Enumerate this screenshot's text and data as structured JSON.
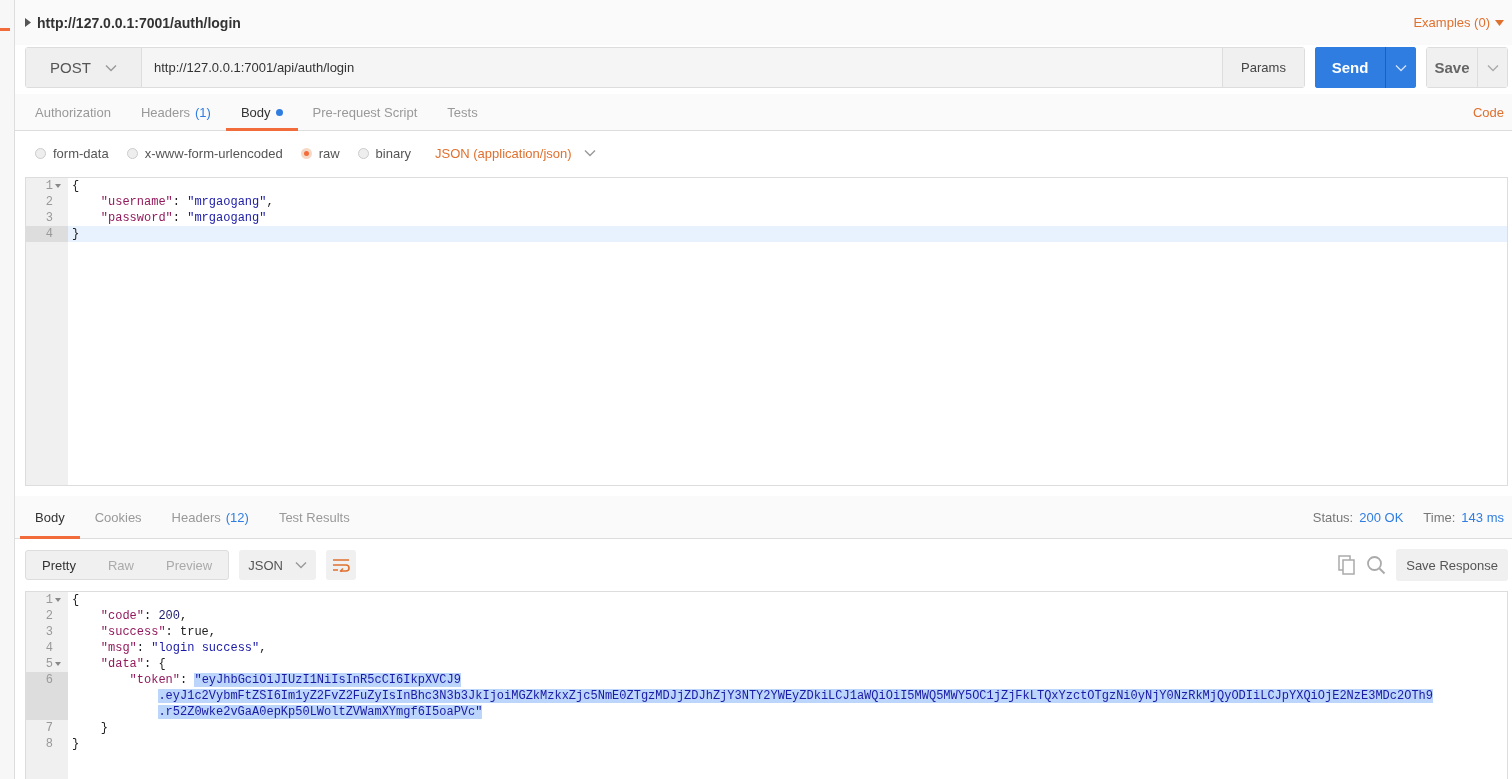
{
  "request_name": {
    "title": "http://127.0.0.1:7001/auth/login",
    "examples": "Examples (0)"
  },
  "url_bar": {
    "method": "POST",
    "url": "http://127.0.0.1:7001/api/auth/login",
    "params": "Params",
    "send": "Send",
    "save": "Save"
  },
  "request_tabs": [
    {
      "label": "Authorization",
      "selected": false,
      "dot": false
    },
    {
      "label": "Headers",
      "count": "(1)",
      "selected": false,
      "dot": false
    },
    {
      "label": "Body",
      "selected": true,
      "dot": true
    },
    {
      "label": "Pre-request Script",
      "selected": false,
      "dot": false
    },
    {
      "label": "Tests",
      "selected": false,
      "dot": false
    }
  ],
  "code_link": "Code",
  "body_modes": [
    {
      "label": "form-data",
      "selected": false
    },
    {
      "label": "x-www-form-urlencoded",
      "selected": false
    },
    {
      "label": "raw",
      "selected": true
    },
    {
      "label": "binary",
      "selected": false
    }
  ],
  "body_type": "JSON (application/json)",
  "request_editor": {
    "lines": [
      {
        "number": "1",
        "fold": true,
        "active": false,
        "tokens": [
          {
            "kind": "punct",
            "text": "{"
          }
        ]
      },
      {
        "number": "2",
        "fold": false,
        "active": false,
        "tokens": [
          {
            "kind": "key",
            "text": "\"username\""
          },
          {
            "kind": "punct",
            "text": ": "
          },
          {
            "kind": "string",
            "text": "\"mrgaogang\""
          },
          {
            "kind": "punct",
            "text": ","
          }
        ]
      },
      {
        "number": "3",
        "fold": false,
        "active": false,
        "tokens": [
          {
            "kind": "key",
            "text": "\"password\""
          },
          {
            "kind": "punct",
            "text": ": "
          },
          {
            "kind": "string",
            "text": "\"mrgaogang\""
          }
        ]
      },
      {
        "number": "4",
        "fold": false,
        "active": true,
        "tokens": [
          {
            "kind": "punct",
            "text": "}"
          }
        ]
      }
    ]
  },
  "response_tabs": [
    {
      "label": "Body",
      "selected": true
    },
    {
      "label": "Cookies",
      "selected": false
    },
    {
      "label": "Headers",
      "count": "(12)",
      "selected": false
    },
    {
      "label": "Test Results",
      "selected": false
    }
  ],
  "status": {
    "label": "Status:",
    "value": "200 OK"
  },
  "time": {
    "label": "Time:",
    "value": "143 ms"
  },
  "view_modes": [
    {
      "label": "Pretty",
      "selected": true
    },
    {
      "label": "Raw",
      "selected": false
    },
    {
      "label": "Preview",
      "selected": false
    }
  ],
  "format": "JSON",
  "save_response": "Save Response",
  "response_editor": {
    "lines": [
      {
        "number": "1",
        "fold": true,
        "active": false,
        "tokens": [
          {
            "kind": "punct",
            "text": "{"
          }
        ]
      },
      {
        "number": "2",
        "fold": false,
        "active": false,
        "tokens": [
          {
            "kind": "key",
            "text": "\"code\""
          },
          {
            "kind": "punct",
            "text": ": "
          },
          {
            "kind": "number",
            "text": "200"
          },
          {
            "kind": "punct",
            "text": ","
          }
        ]
      },
      {
        "number": "3",
        "fold": false,
        "active": false,
        "tokens": [
          {
            "kind": "key",
            "text": "\"success\""
          },
          {
            "kind": "punct",
            "text": ": "
          },
          {
            "kind": "bool",
            "text": "true"
          },
          {
            "kind": "punct",
            "text": ","
          }
        ]
      },
      {
        "number": "4",
        "fold": false,
        "active": false,
        "tokens": [
          {
            "kind": "key",
            "text": "\"msg\""
          },
          {
            "kind": "punct",
            "text": ": "
          },
          {
            "kind": "string",
            "text": "\"login success\""
          },
          {
            "kind": "punct",
            "text": ","
          }
        ]
      },
      {
        "number": "5",
        "fold": true,
        "active": false,
        "tokens": [
          {
            "kind": "key",
            "text": "\"data\""
          },
          {
            "kind": "punct",
            "text": ": {"
          }
        ]
      },
      {
        "number": "6",
        "fold": false,
        "active": true,
        "tokens": [
          {
            "kind": "key",
            "text": "\"token\""
          },
          {
            "kind": "punct",
            "text": ": "
          },
          {
            "kind": "wrapped",
            "selected": true,
            "parts": [
              "\"eyJhbGciOiJIUzI1NiIsInR5cCI6IkpXVCJ9",
              ".eyJ1c2VybmFtZSI6Im1yZ2FvZ2FuZyIsInBhc3N3b3JkIjoiMGZkMzkxZjc5NmE0ZTgzMDJjZDJhZjY3NTY2YWEyZDkiLCJ1aWQiOiI5MWQ5MWY5OC1jZjFkLTQxYzctOTgzNi0yNjY0NzRkMjQyODIiLCJpYXQiOjE2NzE3MDc2OTh9",
              ".r52Z0wke2vGaA0epKp50LWoltZVWamXYmgf6I5oaPVc\""
            ]
          }
        ]
      },
      {
        "number": "7",
        "fold": false,
        "active": false,
        "tokens": [
          {
            "kind": "punct",
            "text": "}"
          }
        ]
      },
      {
        "number": "8",
        "fold": false,
        "active": false,
        "tokens": [
          {
            "kind": "punct",
            "text": "}"
          }
        ]
      }
    ]
  }
}
